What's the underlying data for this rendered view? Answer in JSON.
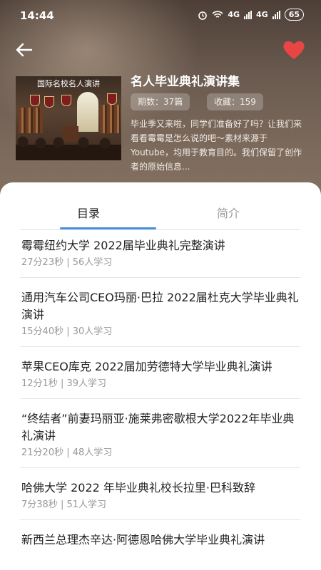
{
  "status_bar": {
    "time": "14:44",
    "network1": "4G",
    "network2": "4G",
    "battery": "65"
  },
  "header": {
    "cover_caption": "国际名校名人演讲",
    "title": "名人毕业典礼演讲集",
    "episodes": "期数：37篇",
    "favorites": "收藏：159",
    "description": "毕业季又来啦，同学们准备好了吗？让我们来看看霉霉是怎么说的吧～素材来源于 Youtube，均用于教育目的。我们保留了创作者的原始信息..."
  },
  "tabs": {
    "catalog": "目录",
    "intro": "简介"
  },
  "items": [
    {
      "title": "霉霉纽约大学 2022届毕业典礼完整演讲",
      "meta": "27分23秒 | 56人学习"
    },
    {
      "title": "通用汽车公司CEO玛丽·巴拉 2022届杜克大学毕业典礼演讲",
      "meta": "15分40秒 | 30人学习"
    },
    {
      "title": "苹果CEO库克 2022届加劳德特大学毕业典礼演讲",
      "meta": "12分1秒 | 39人学习"
    },
    {
      "title": "“终结者”前妻玛丽亚·施莱弗密歇根大学2022年毕业典礼演讲",
      "meta": "21分20秒 | 48人学习"
    },
    {
      "title": "哈佛大学 2022 年毕业典礼校长拉里·巴科致辞",
      "meta": "7分38秒 | 51人学习"
    },
    {
      "title": "新西兰总理杰辛达·阿德恩哈佛大学毕业典礼演讲",
      "meta": ""
    }
  ],
  "colors": {
    "accent": "#4a90e2",
    "favorite": "#e84545"
  },
  "icons": {
    "back": "back-arrow-icon",
    "favorite": "heart-icon"
  }
}
